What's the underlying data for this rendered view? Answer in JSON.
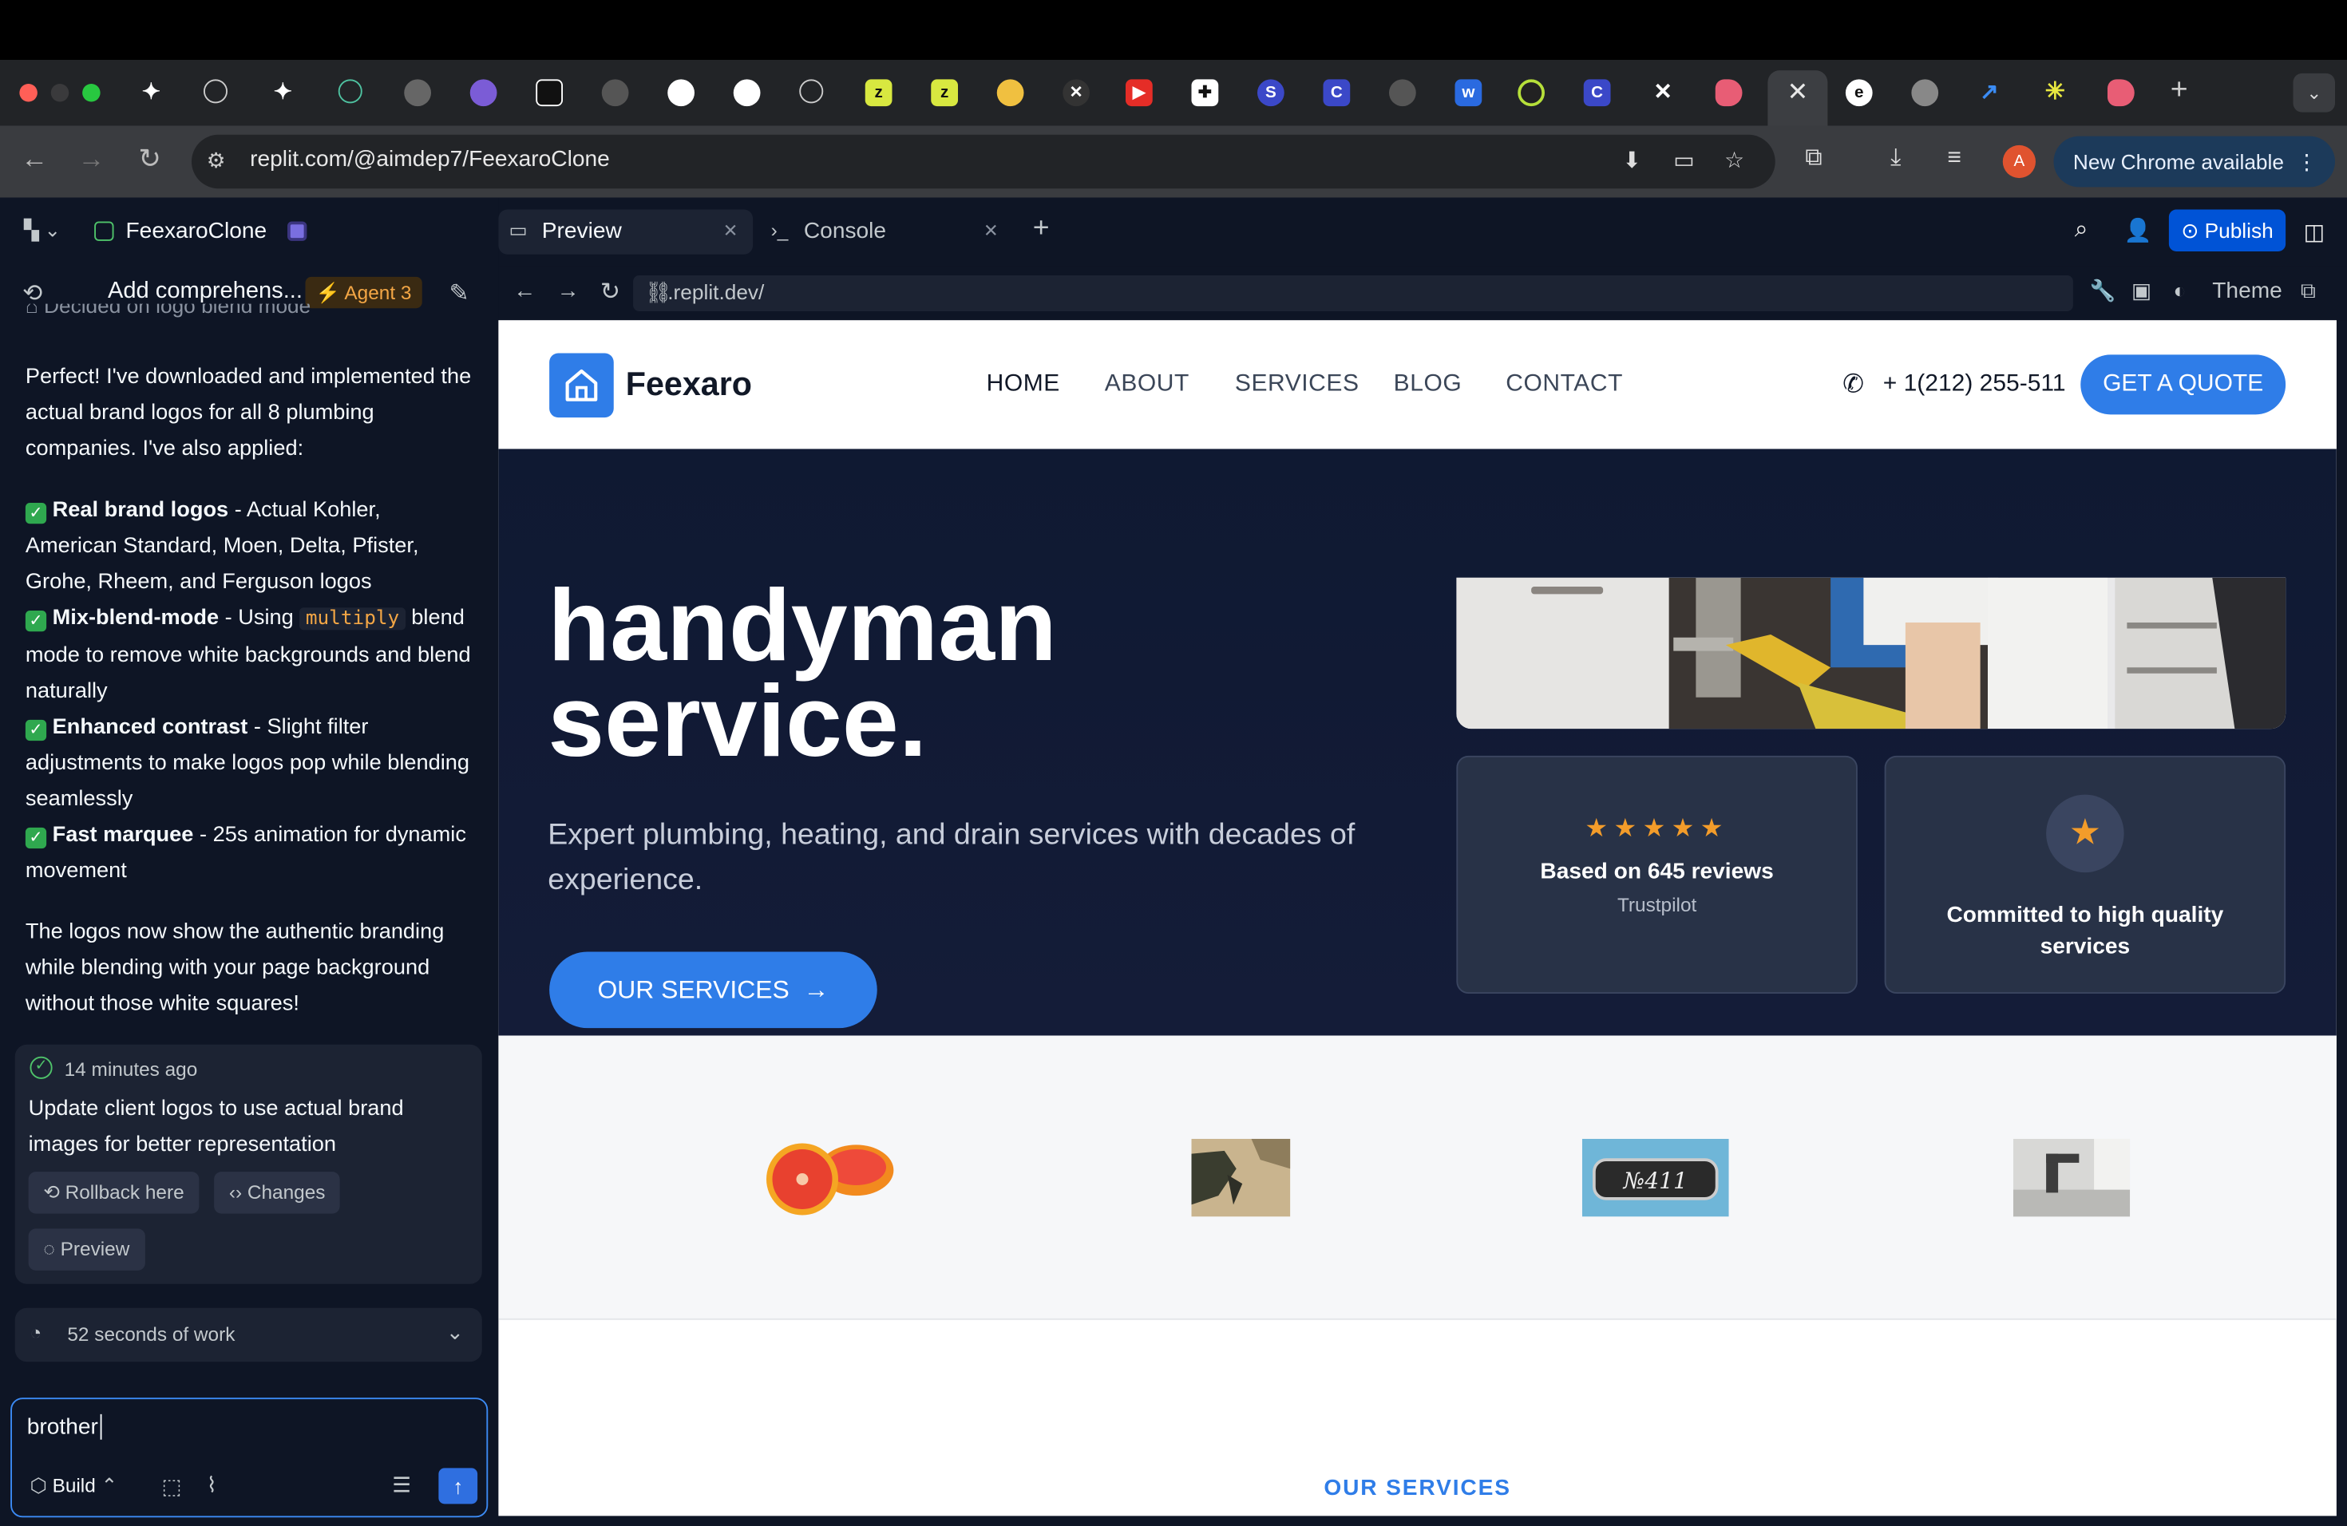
{
  "browser": {
    "url": "replit.com/@aimdep7/FeexaroClone",
    "new_chrome_label": "New Chrome available",
    "avatar_letter": "A",
    "new_tab_symbol": "+",
    "close_tab_symbol": "✕"
  },
  "replit": {
    "project_name": "FeexaroClone",
    "task_title": "Add comprehens...",
    "agent_badge": "Agent 3",
    "clipped_line": "Decided on logo blend mode",
    "message_intro": "Perfect! I've downloaded and implemented the actual brand logos for all 8 plumbing companies. I've also applied:",
    "items": [
      {
        "bold": "Real brand logos",
        "text": " - Actual Kohler, American Standard, Moen, Delta, Pfister, Grohe, Rheem, and Ferguson logos"
      },
      {
        "bold": "Mix-blend-mode",
        "text_before": " - Using ",
        "code": "multiply",
        "text_after": " blend mode to remove white backgrounds and blend naturally"
      },
      {
        "bold": "Enhanced contrast",
        "text": " - Slight filter adjustments to make logos pop while blending seamlessly"
      },
      {
        "bold": "Fast marquee",
        "text": " - 25s animation for dynamic movement"
      }
    ],
    "message_outro": "The logos now show the authentic branding while blending with your page background without those white squares!",
    "checkpoint_time": "14 minutes ago",
    "checkpoint_text": "Update client logos to use actual brand images for better representation",
    "rollback_label": "Rollback here",
    "changes_label": "Changes",
    "preview_label": "Preview",
    "work_label": "52 seconds of work",
    "input_value": "brother",
    "build_label": "Build"
  },
  "workspace": {
    "tab_preview": "Preview",
    "tab_console": "Console",
    "publish_label": "Publish",
    "preview_url": ".replit.dev/",
    "theme_label": "Theme"
  },
  "site": {
    "brand": "Feexaro",
    "nav": [
      "HOME",
      "ABOUT",
      "SERVICES",
      "BLOG",
      "CONTACT"
    ],
    "phone": "+ 1(212) 255-511",
    "quote_label": "GET A QUOTE",
    "headline_1": "handyman",
    "headline_2": "service.",
    "subtitle": "Expert plumbing, heating, and drain services with decades of experience.",
    "cta_label": "OUR SERVICES",
    "stars": "★★★★★",
    "reviews_title": "Based on 645 reviews",
    "reviews_source": "Trustpilot",
    "quality_text": "Committed to high quality services",
    "section_label": "OUR SERVICES"
  },
  "colors": {
    "accent": "#2f7de8",
    "hero_bg": "#121a34",
    "replit_bg": "#0e1525",
    "star": "#f39c2a"
  }
}
